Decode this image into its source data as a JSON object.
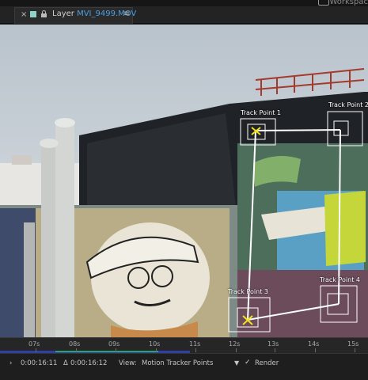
{
  "workspace": {
    "label": "Workspac"
  },
  "tab": {
    "close_glyph": "×",
    "prefix": "Layer",
    "file_name": "MVI_9499.MOV",
    "menu_glyph": "≡",
    "label_color": "#8fd4c9"
  },
  "viewer": {
    "track_points": [
      {
        "label": "Track Point 1"
      },
      {
        "label": "Track Point 2"
      },
      {
        "label": "Track Point 3"
      },
      {
        "label": "Track Point 4"
      }
    ]
  },
  "timeline": {
    "ticks": [
      "07s",
      "08s",
      "09s",
      "10s",
      "11s",
      "12s",
      "13s",
      "14s",
      "15s"
    ]
  },
  "status": {
    "start_arrow": "›",
    "start_time": "0:00:16:11",
    "delta_symbol": "Δ",
    "duration": "0:00:16:12",
    "view_label": "View:",
    "view_value": "Motion Tracker Points",
    "render_label": "Render"
  }
}
